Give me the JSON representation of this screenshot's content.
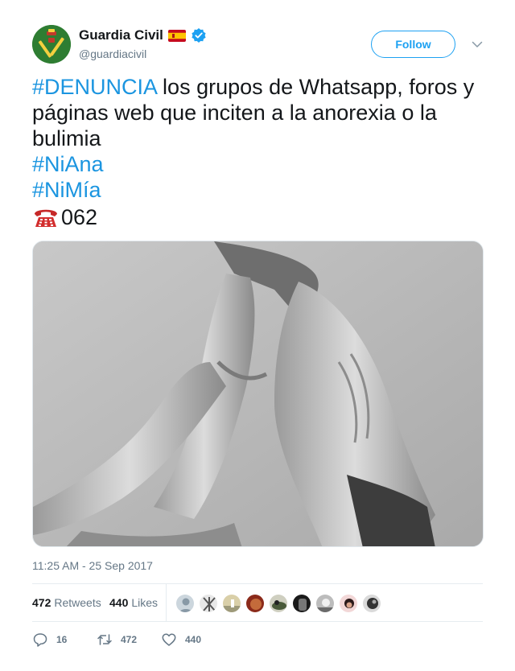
{
  "user": {
    "display_name": "Guardia Civil",
    "screen_name": "@guardiacivil",
    "verified": true,
    "flag_icon": "spain-flag-icon"
  },
  "follow": {
    "label": "Follow"
  },
  "tweet": {
    "hashtag_denuncia": "#DENUNCIA",
    "text_main": " los grupos de Whatsapp, foros y páginas web que inciten a la anorexia o la bulimia",
    "hashtag_niana": "#NiAna",
    "hashtag_nimia": "#NiMía",
    "phone_icon": "telephone-emoji-icon",
    "phone_number": "062"
  },
  "timestamp": "11:25 AM - 25 Sep 2017",
  "stats": {
    "retweets_count": "472",
    "retweets_label": "Retweets",
    "likes_count": "440",
    "likes_label": "Likes"
  },
  "actions": {
    "reply_count": "16",
    "retweet_count": "472",
    "like_count": "440"
  },
  "colors": {
    "link": "#1b95e0",
    "accent": "#1da1f2",
    "secondary_text": "#657786"
  }
}
